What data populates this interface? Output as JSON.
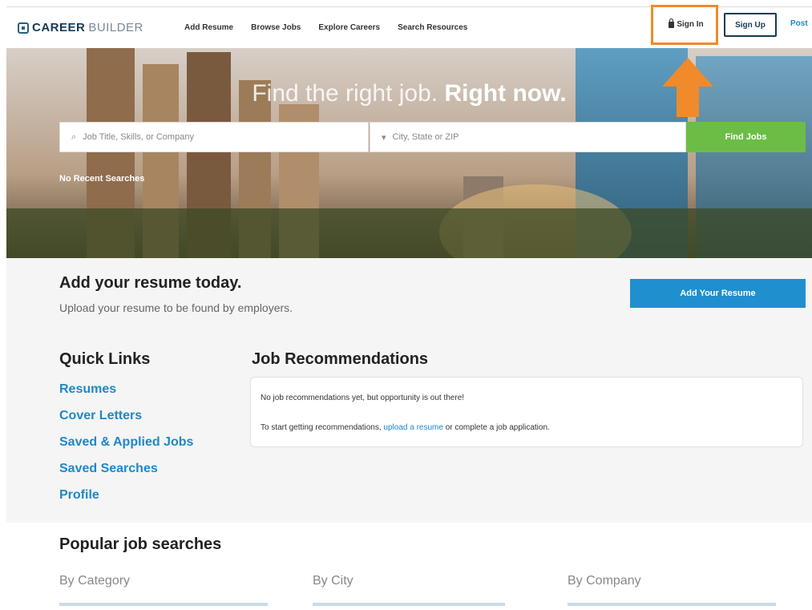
{
  "header": {
    "logo_bold": "CAREER",
    "logo_light": "BUILDER",
    "nav": [
      "Add Resume",
      "Browse Jobs",
      "Explore Careers",
      "Search Resources"
    ],
    "sign_in": "Sign In",
    "sign_up": "Sign Up",
    "post": "Post"
  },
  "hero": {
    "title_light": "Find the right job.",
    "title_bold": "Right now.",
    "job_placeholder": "Job Title, Skills, or Company",
    "location_placeholder": "City, State or ZIP",
    "find_button": "Find Jobs",
    "recent": "No Recent Searches"
  },
  "resume": {
    "title": "Add your resume today.",
    "subtitle": "Upload your resume to be found by employers.",
    "button": "Add Your Resume"
  },
  "quick_links": {
    "title": "Quick Links",
    "items": [
      "Resumes",
      "Cover Letters",
      "Saved & Applied Jobs",
      "Saved Searches",
      "Profile"
    ]
  },
  "recommendations": {
    "title": "Job Recommendations",
    "line1": "No job recommendations yet, but opportunity is out there!",
    "line2_pre": "To start getting recommendations,",
    "line2_link": "upload a resume",
    "line2_post": "or complete a job application."
  },
  "popular": {
    "title": "Popular job searches",
    "by_category": "By Category",
    "by_city": "By City",
    "by_company": "By Company"
  },
  "colors": {
    "accent_orange": "#f08a2a",
    "find_green": "#6cbd45",
    "resume_blue": "#1f8fce",
    "link_blue": "#1e88c8"
  }
}
